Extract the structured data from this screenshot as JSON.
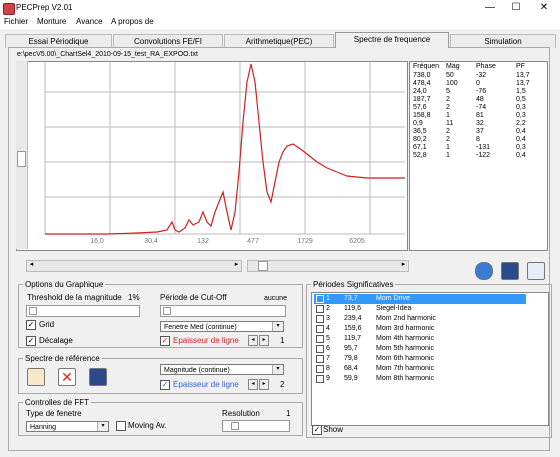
{
  "window": {
    "title": "PECPrep V2.01",
    "minimize": "—",
    "maximize": "☐",
    "close": "✕"
  },
  "menu": [
    "Fichier",
    "Monture",
    "Avance",
    "A propos de"
  ],
  "tabs": [
    "Essai Périodique",
    "Convolutions FE/FI",
    "Arithmetique(PEC)",
    "Spectre de frequence",
    "Simulation"
  ],
  "file_path": "e:\\pecV5.00\\_ChartSel4_2010-09-15_test_RA_EXPOO.txt",
  "plot": {
    "x_ticks": [
      "16,0",
      "30,4",
      "132",
      "477",
      "1729",
      "6205"
    ],
    "accent": "#cc2222"
  },
  "peaks_table": {
    "headers": [
      "Fréquen",
      "Mag",
      "Phase",
      "PF"
    ],
    "rows": [
      [
        "738,0",
        "50",
        "-32",
        "13,7"
      ],
      [
        "478,4",
        "100",
        "0",
        "13,7"
      ],
      [
        "24,0",
        "5",
        "-76",
        "1,5"
      ],
      [
        "187,7",
        "2",
        "48",
        "0,5"
      ],
      [
        "57,6",
        "2",
        "-74",
        "0,3"
      ],
      [
        "158,8",
        "1",
        "81",
        "0,3"
      ],
      [
        "0,9",
        "11",
        "32",
        "2,2"
      ],
      [
        "36,5",
        "2",
        "37",
        "0,4"
      ],
      [
        "80,2",
        "2",
        "8",
        "0,4"
      ],
      [
        "67,1",
        "1",
        "-131",
        "0,3"
      ],
      [
        "52,8",
        "1",
        "-122",
        "0,4"
      ]
    ]
  },
  "options": {
    "legend": "Options du Graphique",
    "threshold_label": "Threshold de la magnitude",
    "threshold_value": "1%",
    "period_label": "Période de Cut-Off",
    "period_value": "aucune",
    "grid_label": "Grid",
    "smoothing_label": "Décalage",
    "display_select": "Fenetre Med (continue)",
    "line_thickness_label": "Epaisseur de ligne",
    "line_thickness_value": "1"
  },
  "reference": {
    "legend": "Spectre de référence",
    "mode_select": "Magnitude (continue)",
    "line_thickness_label": "Epaisseur de ligne",
    "line_thickness_value": "2"
  },
  "fft": {
    "legend": "Controlles de FFT",
    "window_label": "Type de fenetre",
    "window_value": "Hanning",
    "moving_avg_label": "Moving Av.",
    "resolution_label": "Resolution",
    "resolution_value": "1"
  },
  "periods": {
    "legend": "Périodes Significatives",
    "rows": [
      [
        "1",
        "73,7",
        "Mom Drive"
      ],
      [
        "2",
        "119,6",
        "Siegel-Idea"
      ],
      [
        "3",
        "239,4",
        "Mom 2nd harmonic"
      ],
      [
        "4",
        "159,6",
        "Mom 3rd harmonic"
      ],
      [
        "5",
        "119,7",
        "Mom 4th harmonic"
      ],
      [
        "6",
        "95,7",
        "Mom 5th harmonic"
      ],
      [
        "7",
        "79,8",
        "Mom 6th harmonic"
      ],
      [
        "8",
        "68,4",
        "Mom 7th harmonic"
      ],
      [
        "9",
        "59,9",
        "Mom 8th harmonic"
      ]
    ],
    "show_label": "Show"
  },
  "colors": {
    "accent": "#cc2222",
    "selection": "#3399ff"
  }
}
